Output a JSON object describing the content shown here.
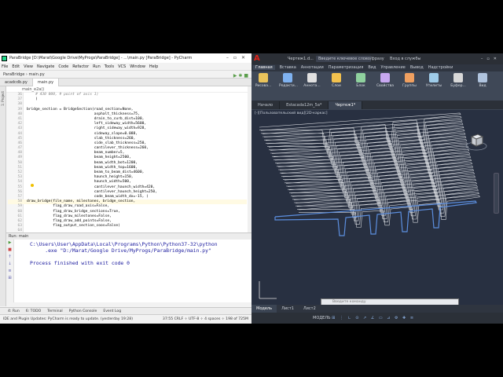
{
  "pycharm": {
    "title": "ParaBridge [D:\\Marat\\Google Drive\\MyProgs\\ParaBridge] - ...\\main.py [ParaBridge] - PyCharm",
    "menu": [
      "File",
      "Edit",
      "View",
      "Navigate",
      "Code",
      "Refactor",
      "Run",
      "Tools",
      "VCS",
      "Window",
      "Help"
    ],
    "nav": "ParaBridge  ›  main.py",
    "tabs": [
      "acadcdb.py",
      "main.py"
    ],
    "crumb": "main_e2a()",
    "left_strip": [
      "1: Project",
      "2: Structure",
      "7: Favorites"
    ],
    "code_lines": [
      {
        "n": "36",
        "t": "    # 430 000, # point of axis 1)",
        "c": true
      },
      {
        "n": "37",
        "t": "    )"
      },
      {
        "n": "38",
        "t": ""
      },
      {
        "n": "39",
        "t": "bridge_section = BridgeSection(road_section=None,"
      },
      {
        "n": "40",
        "t": "                               asphalt_thickness=75,"
      },
      {
        "n": "41",
        "t": "                               drain_to_curb_dist=100,"
      },
      {
        "n": "42",
        "t": "                               left_sideway_width=5600,"
      },
      {
        "n": "43",
        "t": "                               right_sideway_width=928,"
      },
      {
        "n": "44",
        "t": "                               sideway_slope=0.088,"
      },
      {
        "n": "45",
        "t": "                               slab_thickness=260,"
      },
      {
        "n": "46",
        "t": "                               side_slab_thickness=250,"
      },
      {
        "n": "47",
        "t": "                               cantilever_thickness=260,"
      },
      {
        "n": "48",
        "t": "                               beam_number=5,"
      },
      {
        "n": "49",
        "t": "                               beam_height=2500,"
      },
      {
        "n": "50",
        "t": "                               beam_width_bot=1200,"
      },
      {
        "n": "51",
        "t": "                               beam_width_top=1600,"
      },
      {
        "n": "52",
        "t": "                               beam_to_beam_dist=4600,"
      },
      {
        "n": "53",
        "t": "                               haunch_height=150,"
      },
      {
        "n": "54",
        "t": "                               haunch_width=500,"
      },
      {
        "n": "55",
        "t": "                               cantilever_haunch_width=420,"
      },
      {
        "n": "56",
        "t": "                               cantilever_haunch_height=250,"
      },
      {
        "n": "57",
        "t": "                               code_beam_width_dx=-15, )"
      },
      {
        "n": "58",
        "t": "draw_bridge(file_name, milestones, bridge_section,",
        "h": true
      },
      {
        "n": "59",
        "t": "            flag_draw_road_axis=False,"
      },
      {
        "n": "60",
        "t": "            flag_draw_bridge_sections=True,"
      },
      {
        "n": "61",
        "t": "            flag_draw_milestones=False,"
      },
      {
        "n": "62",
        "t": "            flag_draw_add_points=False,"
      },
      {
        "n": "63",
        "t": "            flag_output_section_coos=False)"
      },
      {
        "n": "64",
        "t": ""
      },
      {
        "n": "65",
        "t": ""
      },
      {
        "n": "66",
        "t": "def main_e2a():"
      }
    ],
    "run_tab": "Run:   main",
    "run_output": "C:\\Users\\User\\AppData\\Local\\Programs\\Python\\Python37-32\\python\n     .exe \"D:/Marat/Google Drive/MyProgs/ParaBridge/main.py\"\n\nProcess finished with exit code 0",
    "bottom_tabs": [
      "4: Run",
      "6: TODO",
      "Terminal",
      "Python Console",
      "Event Log"
    ],
    "status_left": "IDE and Plugin Updates: PyCharm is ready to update. (yesterday 19:28)",
    "status_right": "37:55   CRLF ÷   UTF-8 ÷   4 spaces ÷   198 of 725M"
  },
  "autocad": {
    "logo": "A",
    "title": "Чертеж1.d...",
    "search": "Введите ключевое слово/фразу",
    "user": "Вход в службы",
    "ribbon_tabs": [
      "Главная",
      "Вставка",
      "Аннотации",
      "Параметризация",
      "Вид",
      "Управление",
      "Вывод",
      "Надстройки"
    ],
    "ribbon_buttons": [
      "Рисова...",
      "Редакти...",
      "Аннота...",
      "Слои",
      "Блок",
      "Свойства",
      "Группы",
      "Утилиты",
      "Буфер...",
      "Вид"
    ],
    "doc_tabs": [
      "Начало",
      "Estacada12m_5a*",
      "Чертеж1*"
    ],
    "viewport_label": "[-][Пользовательский вид][2D-каркас]",
    "command_placeholder": "Введите команду",
    "layout_tabs": [
      "Модель",
      "Лист1",
      "Лист2"
    ],
    "status": "МОДЕЛЬ"
  }
}
